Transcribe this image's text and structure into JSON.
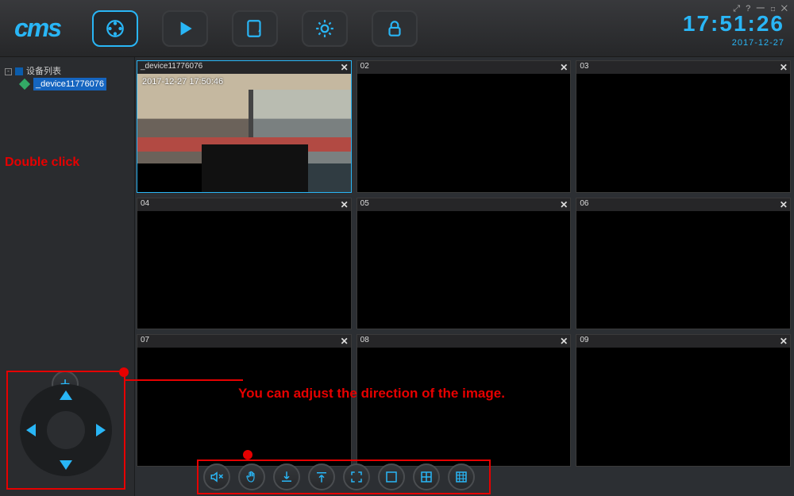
{
  "brand": "cms",
  "clock": {
    "time": "17:51:26",
    "date": "2017-12-27"
  },
  "winctrl": "⤢ ? 一 ◻ ✕",
  "sidebar": {
    "root_label": "设备列表",
    "device_label": "_device11776076",
    "note": "Double click"
  },
  "feed": {
    "title": "_device11776076",
    "osd": "2017-12-27  17:50:46"
  },
  "cells": [
    "02",
    "03",
    "04",
    "05",
    "06",
    "07",
    "08",
    "09"
  ],
  "annotation": "You can adjust the direction of the image.",
  "icons": {
    "reel": "film-reel",
    "play": "play",
    "edit": "edit",
    "gear": "settings",
    "lock": "lock",
    "mute": "speaker-mute",
    "hand": "hand",
    "in": "import",
    "out": "export",
    "full": "fullscreen",
    "g1": "grid-1",
    "g4": "grid-4",
    "g9": "grid-9"
  }
}
